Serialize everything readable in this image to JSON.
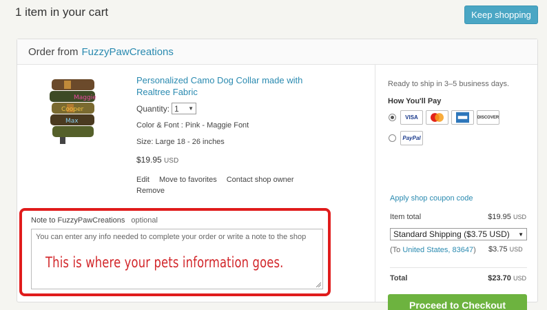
{
  "header": {
    "title": "1 item in your cart",
    "keep_shopping": "Keep shopping"
  },
  "order": {
    "prefix": "Order from",
    "shop_name": "FuzzyPawCreations"
  },
  "item": {
    "title": "Personalized Camo Dog Collar made with Realtree Fabric",
    "quantity_label": "Quantity:",
    "quantity_value": "1",
    "color_font": "Color & Font : Pink - Maggie Font",
    "size": "Size: Large 18 - 26 inches",
    "price": "$19.95",
    "currency": "USD",
    "actions": [
      "Edit",
      "Move to favorites",
      "Contact shop owner"
    ],
    "remove": "Remove",
    "thumb_names": [
      "Maggie",
      "Cooper",
      "Max"
    ]
  },
  "note": {
    "label": "Note to FuzzyPawCreations",
    "optional": "optional",
    "placeholder": "You can enter any info needed to complete your order or write a note to the shop",
    "annotation": "This is where your pets information goes."
  },
  "summary": {
    "ready": "Ready to ship in 3–5 business days.",
    "how_pay": "How You'll Pay",
    "cards": [
      "VISA",
      "MasterCard",
      "AMEX",
      "DISCOVER"
    ],
    "alt_pay": "PayPal",
    "coupon": "Apply shop coupon code",
    "item_total_label": "Item total",
    "item_total_value": "$19.95",
    "currency": "USD",
    "shipping_option": "Standard Shipping ($3.75 USD)",
    "ship_to_prefix": "(To",
    "ship_to_link": "United States, 83647",
    "ship_to_suffix": ")",
    "shipping_value": "$3.75",
    "total_label": "Total",
    "total_value": "$23.70",
    "checkout": "Proceed to Checkout"
  },
  "colors": {
    "accent_blue": "#4aa6c4",
    "link": "#2a8ab0",
    "checkout_green": "#6db33f",
    "highlight_red": "#e01c1c"
  }
}
